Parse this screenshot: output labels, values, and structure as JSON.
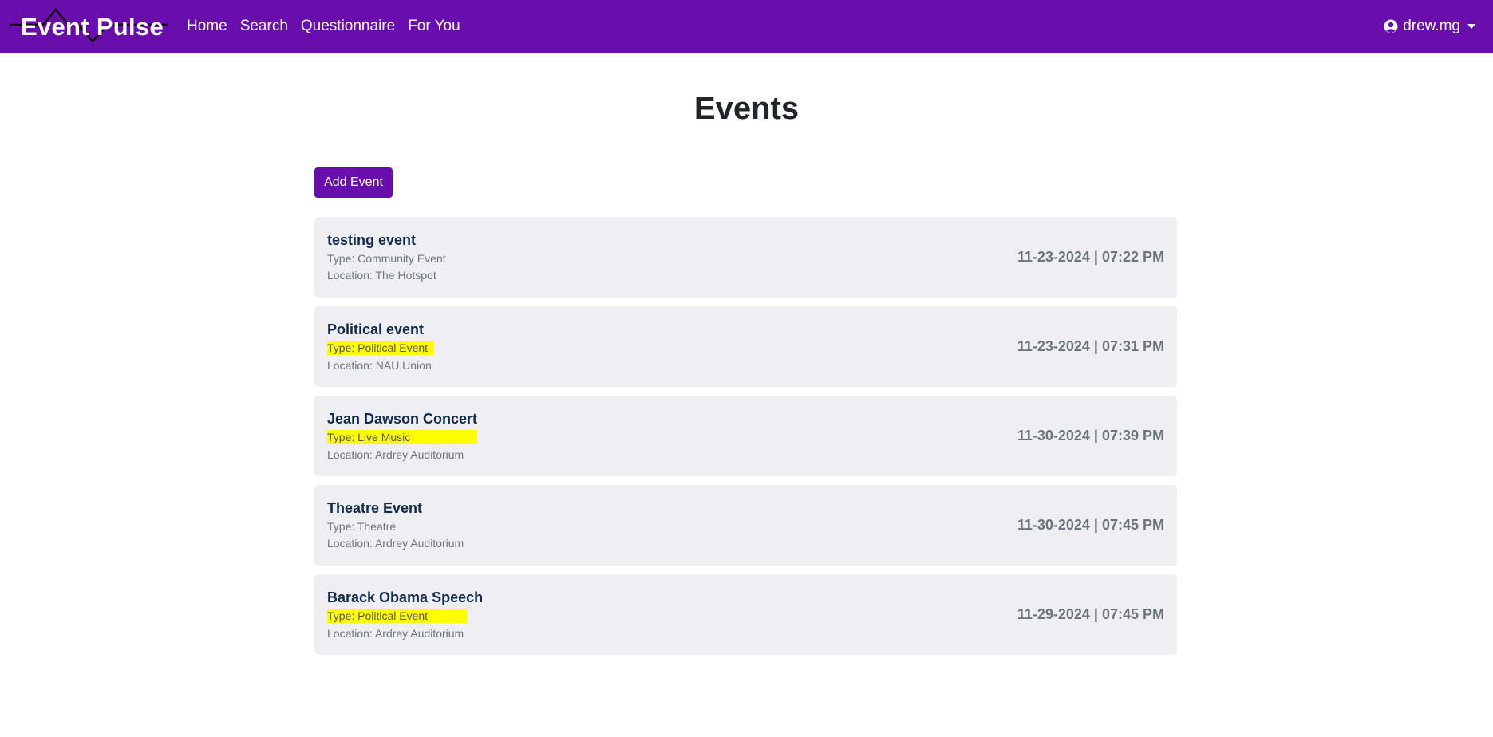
{
  "navbar": {
    "brand": "Event Pulse",
    "links": [
      "Home",
      "Search",
      "Questionnaire",
      "For You"
    ],
    "user": "drew.mg",
    "bg_color": "#6a0dad"
  },
  "page": {
    "title": "Events",
    "add_button": "Add Event"
  },
  "events": [
    {
      "name": "testing event",
      "type": "Type: Community Event",
      "location": "Location: The Hotspot",
      "datetime": "11-23-2024 | 07:22 PM",
      "highlighted": false
    },
    {
      "name": "Political event",
      "type": "Type: Political Event",
      "location": "Location: NAU Union",
      "datetime": "11-23-2024 | 07:31 PM",
      "highlighted": true
    },
    {
      "name": "Jean Dawson Concert",
      "type": "Type: Live Music",
      "location": "Location: Ardrey Auditorium",
      "datetime": "11-30-2024 | 07:39 PM",
      "highlighted": true
    },
    {
      "name": "Theatre Event",
      "type": "Type: Theatre",
      "location": "Location: Ardrey Auditorium",
      "datetime": "11-30-2024 | 07:45 PM",
      "highlighted": false
    },
    {
      "name": "Barack Obama Speech",
      "type": "Type: Political Event",
      "location": "Location: Ardrey Auditorium",
      "datetime": "11-29-2024 | 07:45 PM",
      "highlighted": true
    }
  ],
  "colors": {
    "accent": "#6a0dad",
    "card_bg": "#efeff3",
    "highlight": "#ffff00"
  },
  "icons": {
    "user": "user-circle-icon",
    "caret": "caret-down-icon",
    "logo": "pulse-line-icon"
  }
}
